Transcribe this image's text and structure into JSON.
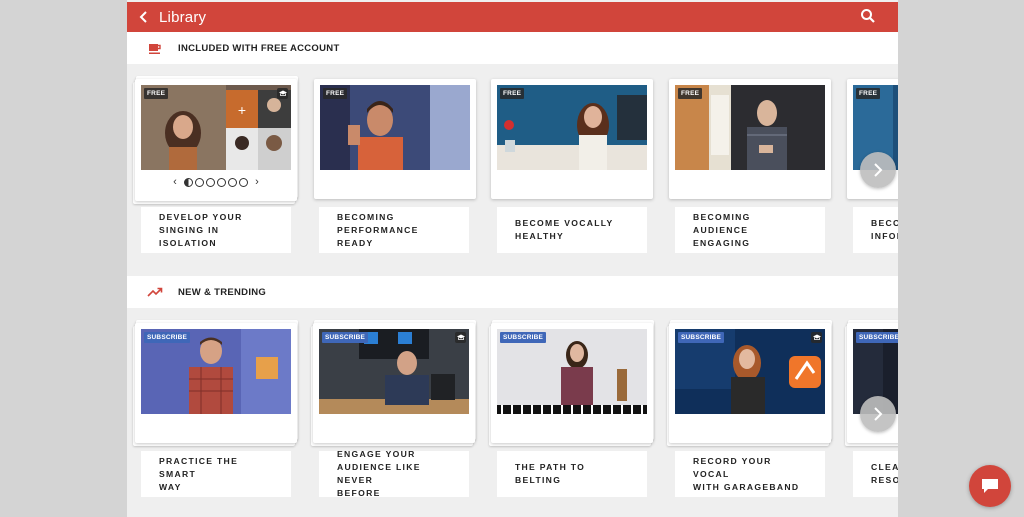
{
  "header": {
    "title": "Library",
    "back_icon": "chevron-left-icon",
    "search_icon": "search-icon",
    "color": "#d1453b"
  },
  "sections": [
    {
      "title": "INCLUDED WITH FREE ACCOUNT",
      "icon": "coffee-cup-icon",
      "cards": [
        {
          "badge": "FREE",
          "label_line1": "DEVELOP YOUR",
          "label_line2": "SINGING IN ISOLATION",
          "label_line3": ""
        },
        {
          "badge": "FREE",
          "label_line1": "BECOMING",
          "label_line2": "PERFORMANCE READY",
          "label_line3": ""
        },
        {
          "badge": "FREE",
          "label_line1": "BECOME VOCALLY",
          "label_line2": "HEALTHY",
          "label_line3": ""
        },
        {
          "badge": "FREE",
          "label_line1": "BECOMING AUDIENCE",
          "label_line2": "ENGAGING",
          "label_line3": ""
        },
        {
          "badge": "FREE",
          "label_line1": "BECON",
          "label_line2": "INFOR",
          "label_line3": ""
        }
      ]
    },
    {
      "title": "NEW & TRENDING",
      "icon": "trending-up-icon",
      "cards": [
        {
          "badge": "SUBSCRIBE",
          "label_line1": "PRACTICE THE SMART",
          "label_line2": "WAY",
          "label_line3": ""
        },
        {
          "badge": "SUBSCRIBE",
          "label_line1": "ENGAGE YOUR",
          "label_line2": "AUDIENCE LIKE NEVER",
          "label_line3": "BEFORE"
        },
        {
          "badge": "SUBSCRIBE",
          "label_line1": "THE PATH TO BELTING",
          "label_line2": "",
          "label_line3": ""
        },
        {
          "badge": "SUBSCRIBE",
          "label_line1": "RECORD YOUR VOCAL",
          "label_line2": "WITH GARAGEBAND",
          "label_line3": ""
        },
        {
          "badge": "SUBSCRIBE",
          "label_line1": "CLEAF",
          "label_line2": "RESON",
          "label_line3": ""
        }
      ]
    }
  ],
  "pager": {
    "total": 6,
    "active_index": 0
  },
  "colors": {
    "accent": "#d1453b",
    "subscribe_badge": "#3f67b8",
    "background": "#efefef"
  }
}
